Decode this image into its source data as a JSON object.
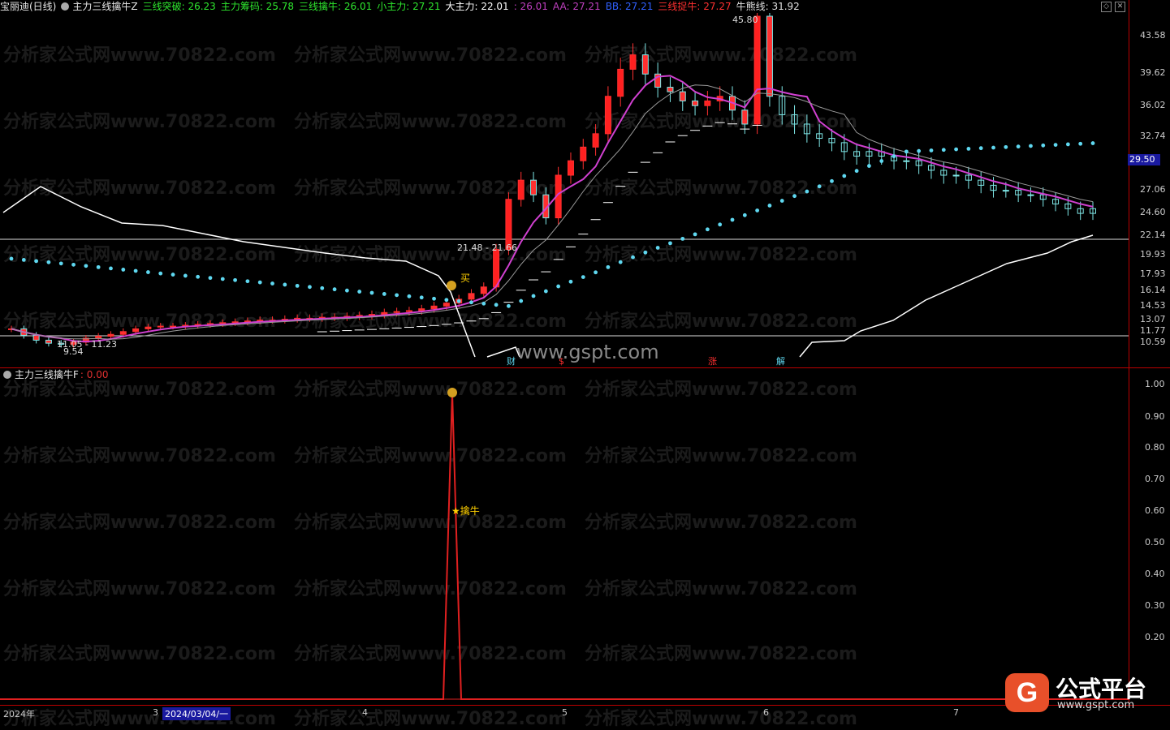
{
  "main_header": {
    "stock": "宝丽迪(日线)",
    "indicator": "主力三线擒牛Z",
    "items": [
      {
        "label": "三线突破",
        "value": "26.23",
        "color": "#2ee62e"
      },
      {
        "label": "主力筹码",
        "value": "25.78",
        "color": "#2ee62e"
      },
      {
        "label": "三线擒牛",
        "value": "26.01",
        "color": "#2ee62e"
      },
      {
        "label": "小主力",
        "value": "27.21",
        "color": "#2ee62e"
      },
      {
        "label": "大主力",
        "value": "22.01",
        "color": "#ffffff"
      },
      {
        "label": "",
        "value": "26.01",
        "color": "#c040c0"
      },
      {
        "label": "AA",
        "value": "27.21",
        "color": "#c040c0"
      },
      {
        "label": "BB",
        "value": "27.21",
        "color": "#3060ff"
      },
      {
        "label": "三线捉牛",
        "value": "27.27",
        "color": "#ff3030"
      },
      {
        "label": "牛熊线",
        "value": "31.92",
        "color": "#e0e0e0"
      }
    ]
  },
  "sub_header": {
    "indicator": "主力三线擒牛F",
    "value": "0.00"
  },
  "price_axis": [
    "43.58",
    "39.62",
    "36.02",
    "32.74",
    "29.50",
    "27.06",
    "24.60",
    "22.14",
    "19.93",
    "17.93",
    "16.14",
    "14.53",
    "13.07",
    "11.77",
    "10.59"
  ],
  "current_price_tag": "29.50",
  "sub_axis": [
    "1.00",
    "0.90",
    "0.80",
    "0.70",
    "0.60",
    "0.50",
    "0.40",
    "0.30",
    "0.20"
  ],
  "annotations": {
    "high": "45.80",
    "low": "9.54",
    "range_left": "11.05 - 11.23",
    "range_mid": "21.48 - 21.66",
    "buy": "买",
    "catch": "擒牛",
    "events": [
      "财",
      "$",
      "涨",
      "解"
    ]
  },
  "x_labels": [
    "2024年",
    "3",
    "2024/03/04/一",
    "4",
    "5",
    "6",
    "7"
  ],
  "watermark": "分析家公式网www.70822.com",
  "site_watermark": "www.gspt.com",
  "logo": {
    "title": "公式平台",
    "url": "www.gspt.com"
  },
  "chart_data": {
    "type": "candlestick",
    "title": "宝丽迪(日线)",
    "ohlc_sequence_note": "",
    "close": [
      12.0,
      11.3,
      10.8,
      10.5,
      10.4,
      10.6,
      11.0,
      11.2,
      11.4,
      11.7,
      12.0,
      12.2,
      12.3,
      12.3,
      12.4,
      12.5,
      12.6,
      12.7,
      12.8,
      12.9,
      13.0,
      13.0,
      13.1,
      13.2,
      13.2,
      13.3,
      13.3,
      13.4,
      13.5,
      13.6,
      13.8,
      13.9,
      14.0,
      14.2,
      14.5,
      14.8,
      15.2,
      15.8,
      16.5,
      20.5,
      26.0,
      28.0,
      26.5,
      24.0,
      28.5,
      30.0,
      31.5,
      33.0,
      37.0,
      40.0,
      41.5,
      39.5,
      38.0,
      37.5,
      36.5,
      36.0,
      36.5,
      37.0,
      35.5,
      34.0,
      45.8,
      37.0,
      35.0,
      34.0,
      33.0,
      32.5,
      32.0,
      31.0,
      30.5,
      31.0,
      30.5,
      30.0,
      30.0,
      29.5,
      29.0,
      28.5,
      28.5,
      28.0,
      27.5,
      27.0,
      27.0,
      26.5,
      26.5,
      26.0,
      25.5,
      25.0,
      24.5,
      25.0
    ],
    "sub_signal": {
      "peak_value": 1.0,
      "label": "擒牛",
      "marker_value": 0.6
    }
  }
}
